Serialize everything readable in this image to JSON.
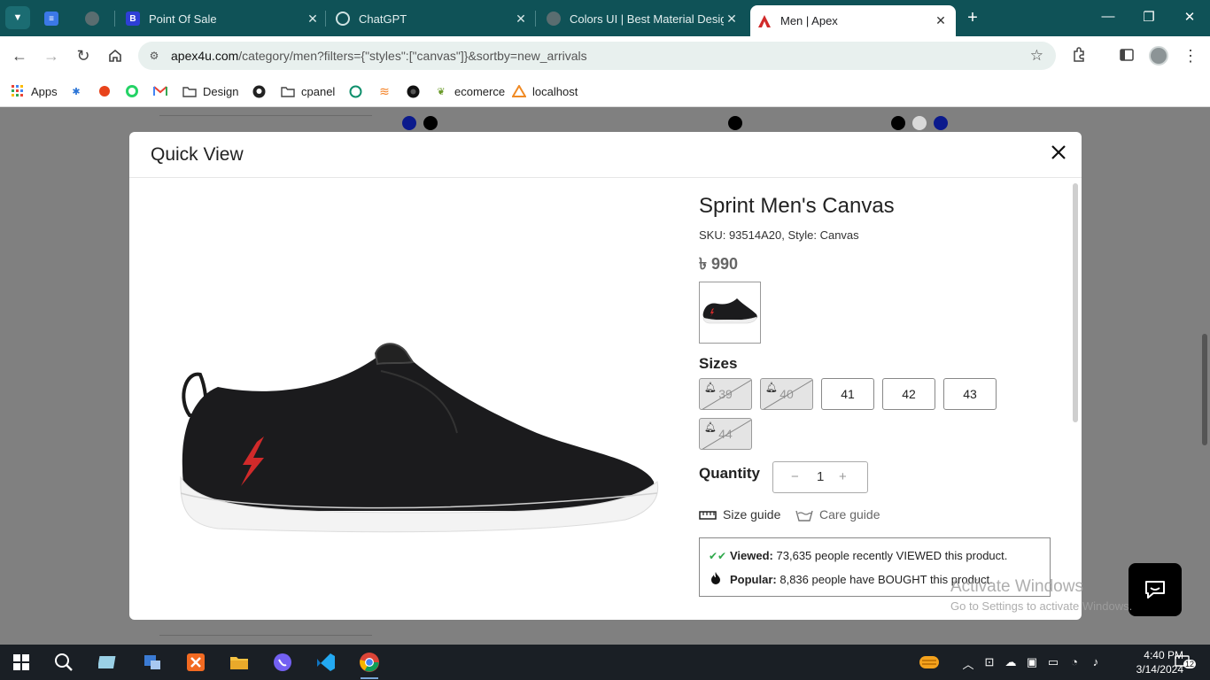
{
  "tabs": [
    {
      "title": "",
      "favicon": "docs-icon"
    },
    {
      "title": "",
      "favicon": "globe-icon"
    },
    {
      "title": "Point Of Sale",
      "favicon": "b-icon"
    },
    {
      "title": "ChatGPT",
      "favicon": "chatgpt-icon"
    },
    {
      "title": "Colors UI | Best Material Design",
      "favicon": "globe-icon"
    },
    {
      "title": "Men | Apex",
      "favicon": "apex-icon",
      "active": true
    }
  ],
  "toolbar": {
    "url_host": "apex4u.com",
    "url_path": "/category/men?filters={\"styles\":[\"canvas\"]}&sortby=new_arrivals"
  },
  "bookmarks": [
    {
      "label": "Apps",
      "icon": "apps-grid-icon"
    },
    {
      "label": "",
      "icon": "bug-icon"
    },
    {
      "label": "",
      "icon": "red-dot-icon"
    },
    {
      "label": "",
      "icon": "whatsapp-icon"
    },
    {
      "label": "",
      "icon": "gmail-icon"
    },
    {
      "label": "Design",
      "icon": "folder-icon"
    },
    {
      "label": "",
      "icon": "github-icon"
    },
    {
      "label": "cpanel",
      "icon": "folder-icon"
    },
    {
      "label": "",
      "icon": "chatgpt-icon"
    },
    {
      "label": "",
      "icon": "stackoverflow-icon"
    },
    {
      "label": "",
      "icon": "dark-circle-icon"
    },
    {
      "label": "ecomerce",
      "icon": "leaf-icon"
    },
    {
      "label": "localhost",
      "icon": "xampp-icon"
    }
  ],
  "background_swatches": [
    "#0b1a8c",
    "#000000",
    "#000000",
    "#000000",
    "#d9d9d9",
    "#0b1a8c"
  ],
  "modal": {
    "title": "Quick View",
    "product": {
      "name": "Sprint Men's Canvas",
      "sku_line": "SKU: 93514A20, Style: Canvas",
      "price": "৳ 990",
      "sizes_label": "Sizes",
      "sizes": [
        {
          "label": "39",
          "available": false
        },
        {
          "label": "40",
          "available": false
        },
        {
          "label": "41",
          "available": true
        },
        {
          "label": "42",
          "available": true
        },
        {
          "label": "43",
          "available": true
        },
        {
          "label": "44",
          "available": false
        }
      ],
      "quantity_label": "Quantity",
      "quantity": "1",
      "size_guide": "Size guide",
      "care_guide": "Care guide",
      "viewed_label": "Viewed:",
      "viewed_text": "73,635 people recently VIEWED this product.",
      "popular_label": "Popular:",
      "popular_text": "8,836 people have BOUGHT this product."
    }
  },
  "watermark": {
    "line1": "Activate Windows",
    "line2": "Go to Settings to activate Windows."
  },
  "taskbar": {
    "time": "4:40 PM",
    "date": "3/14/2024",
    "notifications": "12"
  },
  "colors": {
    "tabbar": "#0f5257",
    "accent": "#0b1a8c",
    "shoe_red": "#d12a2a"
  }
}
